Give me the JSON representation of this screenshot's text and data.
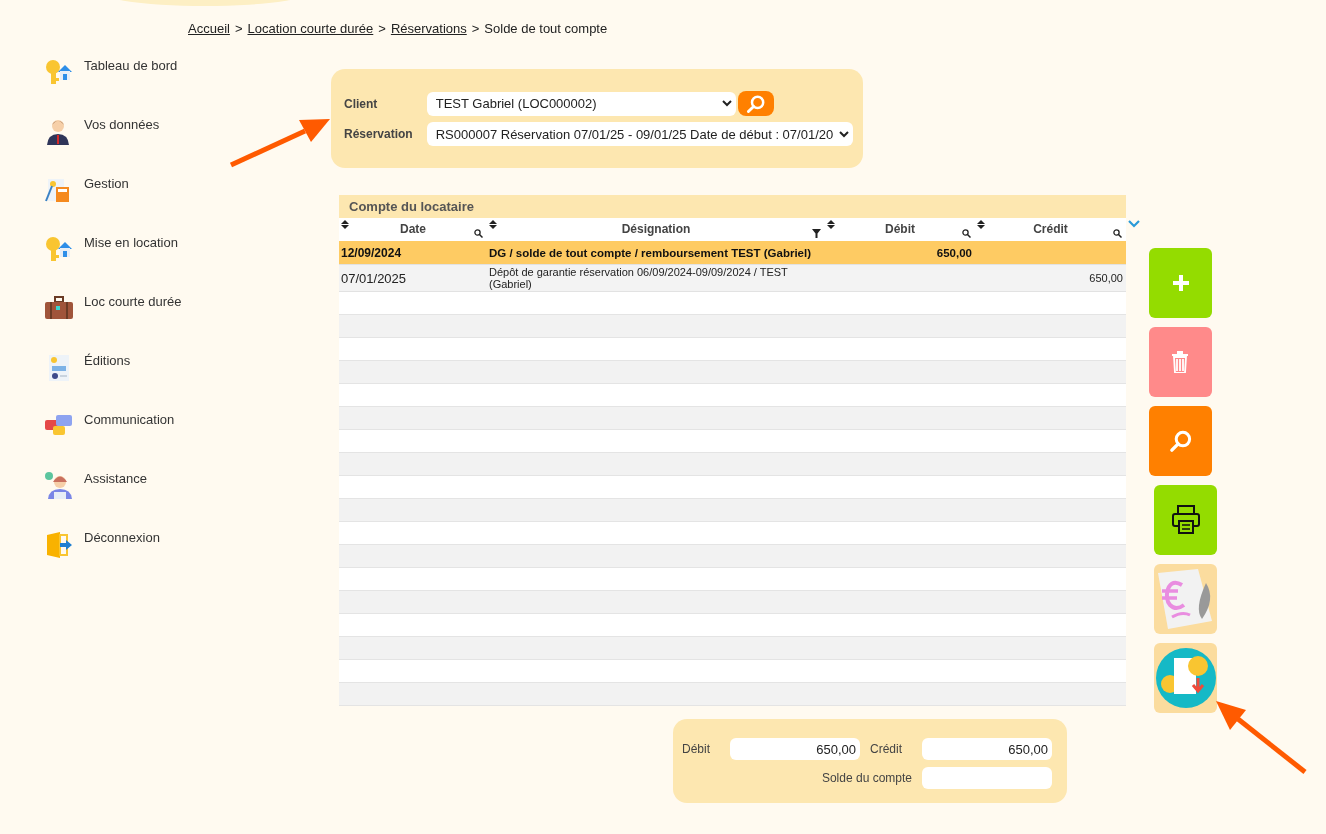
{
  "breadcrumb": [
    {
      "kind": "link",
      "text": "Accueil"
    },
    {
      "kind": "separator",
      "text": ">"
    },
    {
      "kind": "link",
      "text": "Location courte durée"
    },
    {
      "kind": "separator",
      "text": ">"
    },
    {
      "kind": "link",
      "text": "Réservations"
    },
    {
      "kind": "separator",
      "text": ">"
    },
    {
      "kind": "current",
      "text": "Solde de tout compte"
    }
  ],
  "sidebar": {
    "items": [
      {
        "kind": "keys-house",
        "label": "Tableau de bord"
      },
      {
        "kind": "person",
        "label": "Vos données"
      },
      {
        "kind": "calculator",
        "label": "Gestion"
      },
      {
        "kind": "keys-house",
        "label": "Mise en location"
      },
      {
        "kind": "suitcase",
        "label": "Loc courte durée"
      },
      {
        "kind": "report",
        "label": "Éditions"
      },
      {
        "kind": "chat",
        "label": "Communication"
      },
      {
        "kind": "support",
        "label": "Assistance"
      },
      {
        "kind": "exit",
        "label": "Déconnexion"
      }
    ]
  },
  "filter": {
    "fields": [
      {
        "label": "Client",
        "value": "TEST Gabriel (LOC000002)",
        "search_button": true
      },
      {
        "label": "Réservation",
        "value": "RS000007 Réservation 07/01/25 - 09/01/25 Date de début : 07/01/20",
        "search_button": false
      }
    ]
  },
  "table": {
    "title": "Compte du locataire",
    "columns": [
      {
        "label": "Date",
        "filtered": false
      },
      {
        "label": "Désignation",
        "filtered": true
      },
      {
        "label": "Débit",
        "filtered": false
      },
      {
        "label": "Crédit",
        "filtered": false
      }
    ],
    "rows": [
      {
        "selected": true,
        "date": "12/09/2024",
        "designation": "DG / solde de tout compte / remboursement TEST (Gabriel)",
        "debit": "650,00"
      },
      {
        "selected": false,
        "date": "07/01/2025",
        "designation": "Dépôt de garantie réservation 06/09/2024-09/09/2024 / TEST (Gabriel)",
        "credit": "650,00"
      }
    ]
  },
  "actions": [
    {
      "kind": "add"
    },
    {
      "kind": "delete"
    },
    {
      "kind": "search"
    },
    {
      "kind": "print"
    },
    {
      "kind": "invoice"
    },
    {
      "kind": "refund"
    }
  ],
  "totals": {
    "debit": {
      "label": "Débit",
      "value": "650,00"
    },
    "credit": {
      "label": "Crédit",
      "value": "650,00"
    },
    "balance": {
      "label": "Solde du compte"
    }
  },
  "annotations": [
    {
      "kind": "arrow"
    },
    {
      "kind": "arrow"
    }
  ]
}
